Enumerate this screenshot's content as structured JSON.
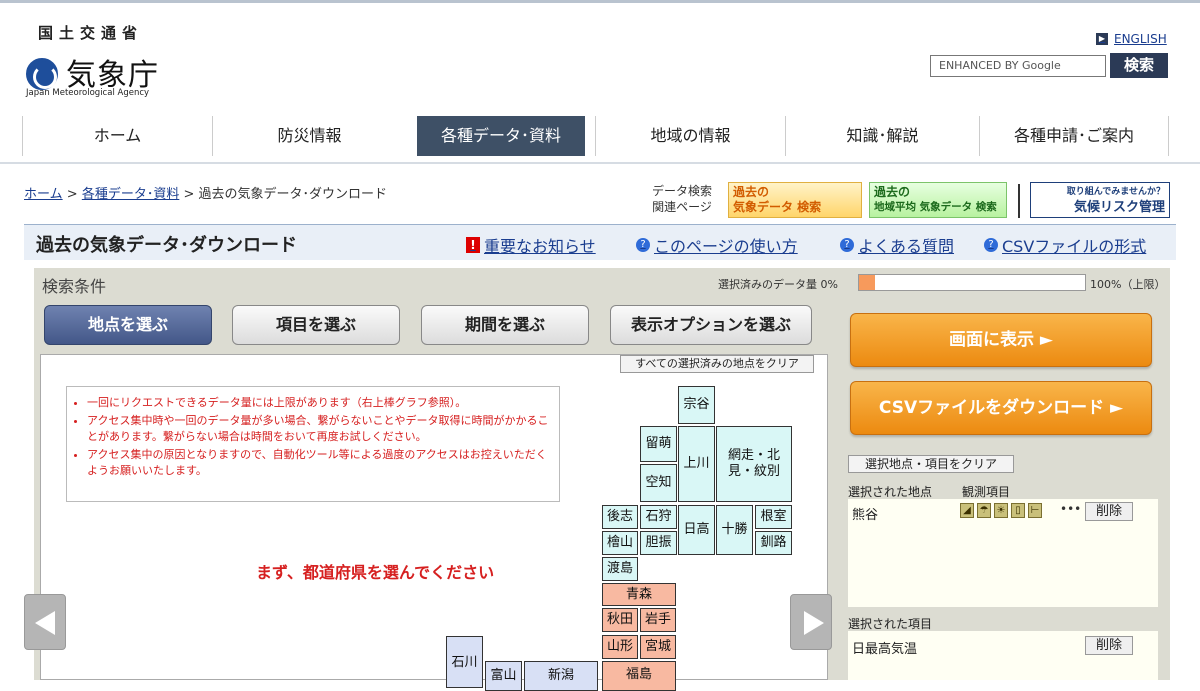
{
  "header": {
    "ministry": "国土交通省",
    "agency": "気象庁",
    "agency_en": "Japan Meteorological Agency",
    "english_link": "ENGLISH",
    "search_placeholder": "ENHANCED BY Google",
    "search_button": "検索"
  },
  "nav": [
    {
      "label": "ホーム"
    },
    {
      "label": "防災情報"
    },
    {
      "label": "各種データ･資料",
      "active": true
    },
    {
      "label": "地域の情報"
    },
    {
      "label": "知識･解説"
    },
    {
      "label": "各種申請･ご案内"
    }
  ],
  "breadcrumb": {
    "home": "ホーム",
    "data": "各種データ･資料",
    "current": "過去の気象データ･ダウンロード",
    "sep": ">"
  },
  "related": {
    "line1": "データ検索",
    "line2": "関連ページ"
  },
  "banners": [
    {
      "line1": "過去の",
      "line2": "気象データ 検索"
    },
    {
      "line1": "過去の",
      "line2": "地域平均 気象データ 検索"
    },
    {
      "line1": "取り組んでみませんか？",
      "line2": "気候リスク管理"
    }
  ],
  "titlebar": {
    "title": "過去の気象データ･ダウンロード",
    "important": "重要なお知らせ",
    "howto": "このページの使い方",
    "faq": "よくある質問",
    "csv": "CSVファイルの形式"
  },
  "search": {
    "label": "検索条件",
    "quota_label": "選択済みのデータ量 0%",
    "quota_max": "100%（上限）",
    "quota_fraction": 0.07
  },
  "tabs": [
    {
      "label": "地点を選ぶ",
      "active": true
    },
    {
      "label": "項目を選ぶ"
    },
    {
      "label": "期間を選ぶ"
    },
    {
      "label": "表示オプションを選ぶ"
    }
  ],
  "clear_all": "すべての選択済みの地点をクリア",
  "notices": [
    "一回にリクエストできるデータ量には上限があります（右上棒グラフ参照）。",
    "アクセス集中時や一回のデータ量が多い場合、繋がらないことやデータ取得に時間がかかることがあります。繋がらない場合は時間をおいて再度お試しください。",
    "アクセス集中の原因となりますので、自動化ツール等による過度のアクセスはお控えいただくようお願いいたします。"
  ],
  "prompt": "まず、都道府県を選んでください",
  "prefectures": {
    "soya": "宗谷",
    "rumoi": "留萌",
    "kamikawa": "上川",
    "abashiri": "網走・北見・紋別",
    "sorachi": "空知",
    "shiribeshi": "後志",
    "ishikari": "石狩",
    "hidaka": "日高",
    "tokachi": "十勝",
    "nemuro": "根室",
    "hiyama": "檜山",
    "iburi": "胆振",
    "kushiro": "釧路",
    "oshima": "渡島",
    "aomori": "青森",
    "akita": "秋田",
    "iwate": "岩手",
    "yamagata": "山形",
    "miyagi": "宮城",
    "ishikawa": "石川",
    "toyama": "富山",
    "niigata": "新潟",
    "fukushima": "福島"
  },
  "actions": {
    "display": "画面に表示 ►",
    "csv": "CSVファイルをダウンロード ►"
  },
  "selection": {
    "clear": "選択地点・項目をクリア",
    "stations_label": "選択された地点",
    "obs_label": "観測項目",
    "station": "熊谷",
    "obs_dots": "•••",
    "delete": "削除",
    "items_label": "選択された項目",
    "item": "日最高気温"
  }
}
